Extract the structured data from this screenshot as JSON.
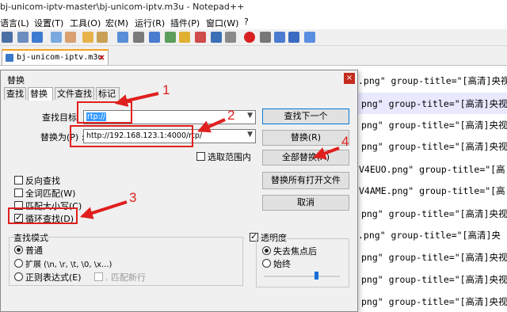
{
  "window": {
    "title": "bj-unicom-iptv-master\\bj-unicom-iptv.m3u - Notepad++"
  },
  "menu": [
    "语言(L)",
    "设置(T)",
    "工具(O)",
    "宏(M)",
    "运行(R)",
    "插件(P)",
    "窗口(W)",
    "?"
  ],
  "tab": {
    "filename": "bj-unicom-iptv.m3u"
  },
  "editor_lines": [
    ".png\" group-title=\"[高清]央视",
    "png\" group-title=\"[高清]央视",
    "png\" group-title=\"[高清]央视",
    "png\" group-title=\"[高清]央视",
    "V4EUO.png\" group-title=\"[高",
    "V4AME.png\" group-title=\"[高",
    "png\" group-title=\"[高清]央视",
    ".png\" group-title=\"[高清]央",
    "png\" group-title=\"[高清]央视",
    "png\" group-title=\"[高清]央视",
    "png\" group-title=\"[高清]央视"
  ],
  "dialog": {
    "title": "替换",
    "close": "×",
    "tabs": [
      "查找",
      "替换",
      "文件查找",
      "标记"
    ],
    "find_label": "查找目标",
    "find_value": "rtp://",
    "replace_label": "替换为(P) :",
    "replace_value": "http://192.168.123.1:4000/rtp/",
    "in_selection": "选取范围内",
    "options": [
      "反向查找",
      "全词匹配(W)",
      "匹配大小写(C)",
      "循环查找(D)"
    ],
    "search_mode": {
      "title": "查找模式",
      "modes": [
        "普通",
        "扩展 (\\n, \\r, \\t, \\0, \\x...)",
        "正则表达式(E)"
      ],
      "dot_newline": ". 匹配新行"
    },
    "transparency": {
      "title": "透明度",
      "options": [
        "失去焦点后",
        "始终"
      ]
    },
    "buttons": {
      "find_next": "查找下一个",
      "replace": "替换(R)",
      "replace_all": "全部替换(A)",
      "replace_all_open": "替换所有打开文件",
      "cancel": "取消"
    }
  },
  "annotations": [
    "1",
    "2",
    "3",
    "4"
  ],
  "annotation_color": "#e0201e"
}
